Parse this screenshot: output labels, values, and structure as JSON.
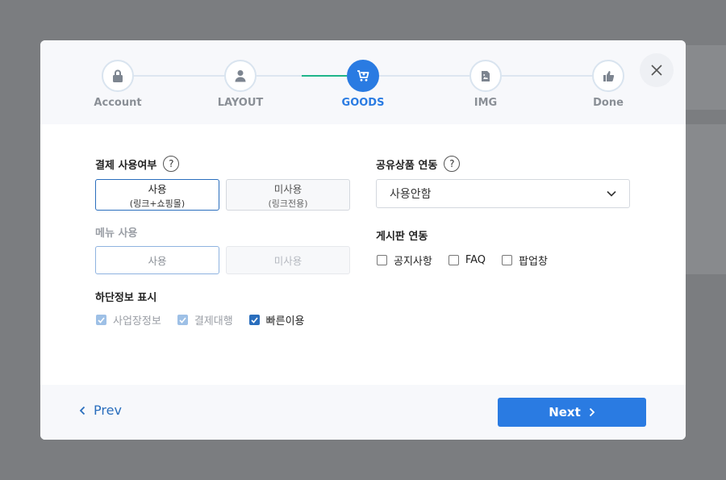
{
  "stepper": {
    "steps": [
      {
        "label": "Account",
        "icon": "lock-icon"
      },
      {
        "label": "LAYOUT",
        "icon": "user-icon"
      },
      {
        "label": "GOODS",
        "icon": "cart-icon",
        "active": true
      },
      {
        "label": "IMG",
        "icon": "image-file-icon"
      },
      {
        "label": "Done",
        "icon": "thumbs-up-icon"
      }
    ]
  },
  "payment": {
    "label": "결제 사용여부",
    "help": "?",
    "options": [
      {
        "label": "사용",
        "sub": "(링크+쇼핑몰)",
        "selected": true
      },
      {
        "label": "미사용",
        "sub": "(링크전용)",
        "selected": false
      }
    ]
  },
  "menu": {
    "label": "메뉴 사용",
    "options": [
      {
        "label": "사용"
      },
      {
        "label": "미사용"
      }
    ]
  },
  "footer_info": {
    "label": "하단정보 표시",
    "items": [
      {
        "label": "사업장정보",
        "checked": true
      },
      {
        "label": "결제대행",
        "checked": true
      },
      {
        "label": "빠른이용",
        "checked": true
      }
    ]
  },
  "shared_goods": {
    "label": "공유상품 연동",
    "help": "?",
    "selected": "사용안함"
  },
  "board": {
    "label": "게시판 연동",
    "items": [
      {
        "label": "공지사항",
        "checked": false
      },
      {
        "label": "FAQ",
        "checked": false
      },
      {
        "label": "팝업창",
        "checked": false
      }
    ]
  },
  "nav": {
    "prev": "Prev",
    "next": "Next"
  },
  "colors": {
    "accent": "#2a7be2",
    "progress": "#1fb58a",
    "overlay": "#7b7d80"
  }
}
